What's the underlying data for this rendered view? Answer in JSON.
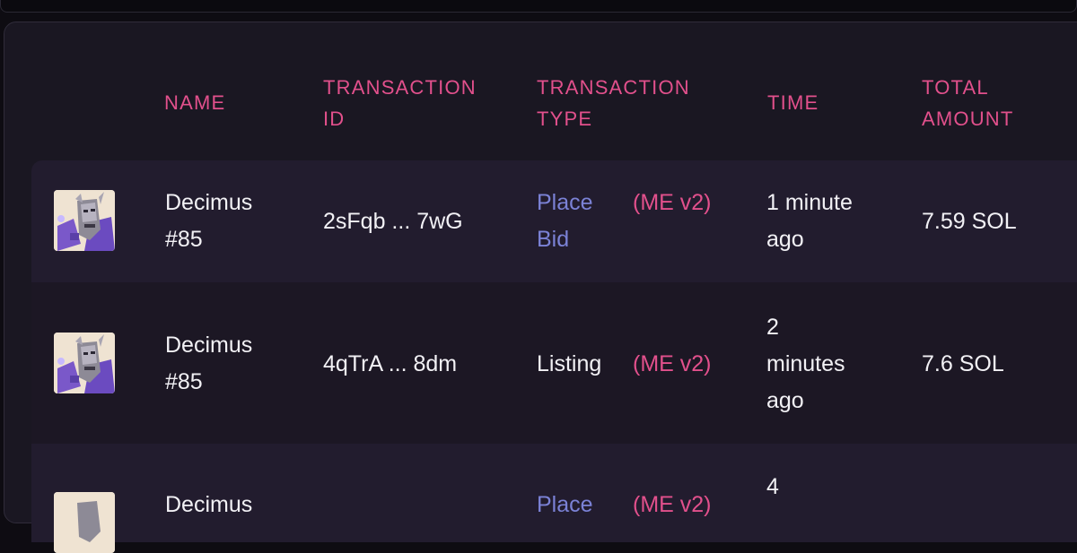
{
  "table": {
    "headers": {
      "name": "NAME",
      "transaction_id_line1": "TRANSACTION",
      "transaction_id_line2": "ID",
      "transaction_type_line1": "TRANSACTION",
      "transaction_type_line2": "TYPE",
      "time": "TIME",
      "total_amount_line1": "TOTAL",
      "total_amount_line2": "AMOUNT"
    },
    "rows": [
      {
        "name_line1": "Decimus",
        "name_line2": "#85",
        "tx_id": "2sFqb ... 7wG",
        "type_line1": "Place",
        "type_line2": "Bid",
        "type_style": "link",
        "marketplace": "(ME v2)",
        "time_line1": "1 minute",
        "time_line2": "ago",
        "amount": "7.59 SOL",
        "image_icon": "robot-nft-thumbnail"
      },
      {
        "name_line1": "Decimus",
        "name_line2": "#85",
        "tx_id": "4qTrA ... 8dm",
        "type_line1": "Listing",
        "type_style": "plain",
        "marketplace": "(ME v2)",
        "time_line1": "2",
        "time_line2": "minutes",
        "time_line3": "ago",
        "amount": "7.6 SOL",
        "image_icon": "robot-nft-thumbnail"
      },
      {
        "name_line1": "Decimus",
        "type_line1": "Place",
        "marketplace": "(ME v2)",
        "time_line1": "4",
        "image_icon": "robot-nft-thumbnail"
      }
    ]
  },
  "colors": {
    "accent_pink": "#e2508c",
    "link_blue": "#7b82d6",
    "text": "#f2f1f5",
    "panel_bg": "#1a1722",
    "row_alt_bg": "#221c2e"
  }
}
